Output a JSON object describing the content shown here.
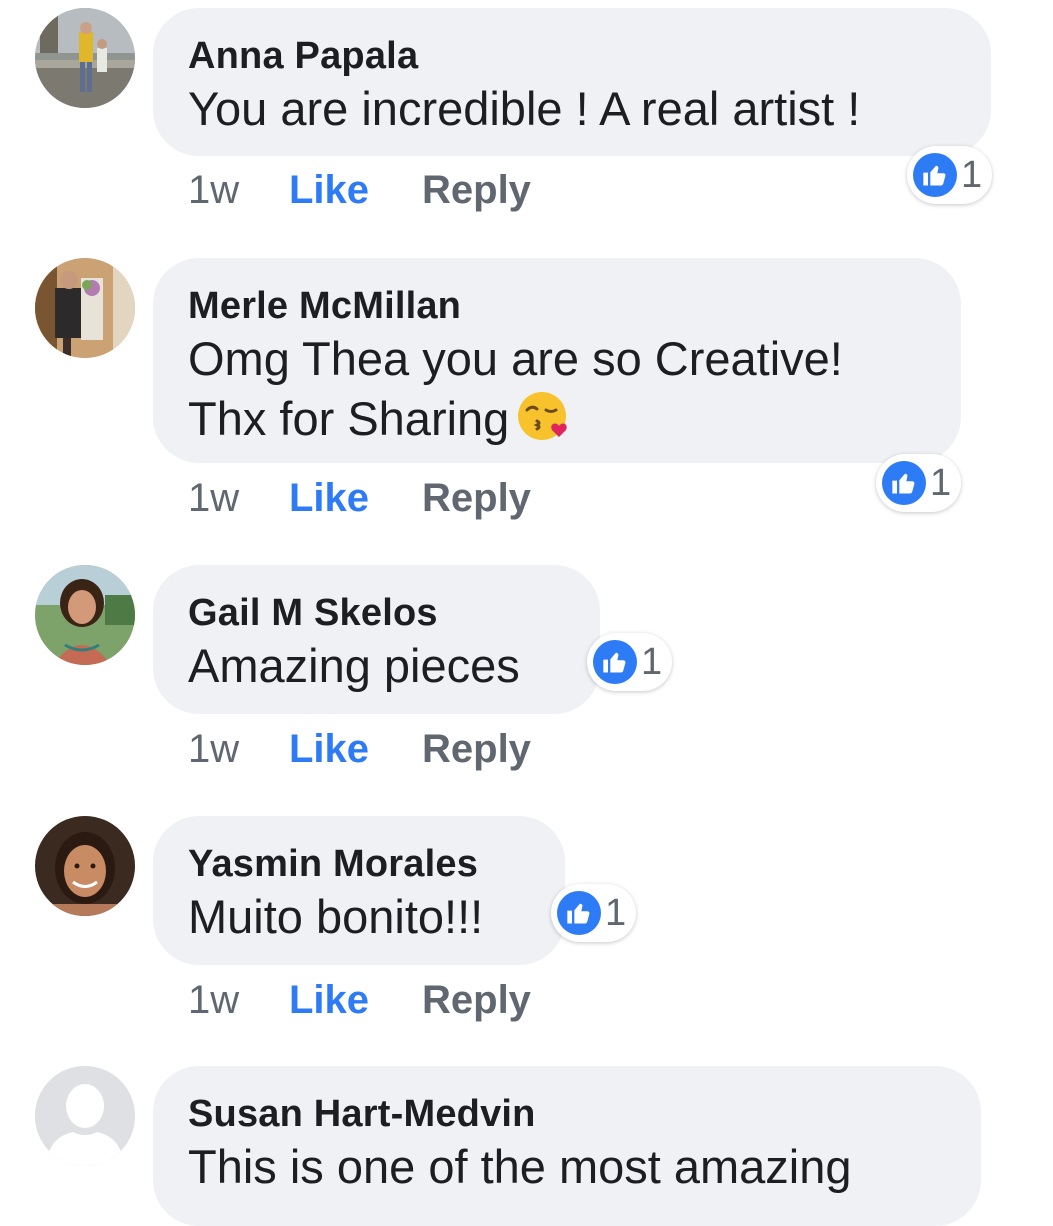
{
  "colors": {
    "bubble_background": "#f0f1f4",
    "like_blue": "#2e7bf6",
    "secondary_text": "#606770",
    "primary_text": "#1c1e21"
  },
  "icons": {
    "reaction": "thumbs-up-icon",
    "emoji": "face-blowing-kiss-emoji",
    "default_avatar": "default-user-silhouette"
  },
  "comments": [
    {
      "author": "Anna Papala",
      "text": "You are incredible ! A real artist !",
      "reaction_count": "1",
      "time": "1w",
      "like_label": "Like",
      "reply_label": "Reply"
    },
    {
      "author": "Merle McMillan",
      "text_line1": "Omg Thea you are so Creative!",
      "text_line2": "Thx for Sharing",
      "reaction_count": "1",
      "time": "1w",
      "like_label": "Like",
      "reply_label": "Reply"
    },
    {
      "author": "Gail M Skelos",
      "text": "Amazing pieces",
      "reaction_count": "1",
      "time": "1w",
      "like_label": "Like",
      "reply_label": "Reply"
    },
    {
      "author": "Yasmin Morales",
      "text": "Muito bonito!!!",
      "reaction_count": "1",
      "time": "1w",
      "like_label": "Like",
      "reply_label": "Reply"
    },
    {
      "author": "Susan Hart-Medvin",
      "text": "This is one of the most amazing"
    }
  ]
}
